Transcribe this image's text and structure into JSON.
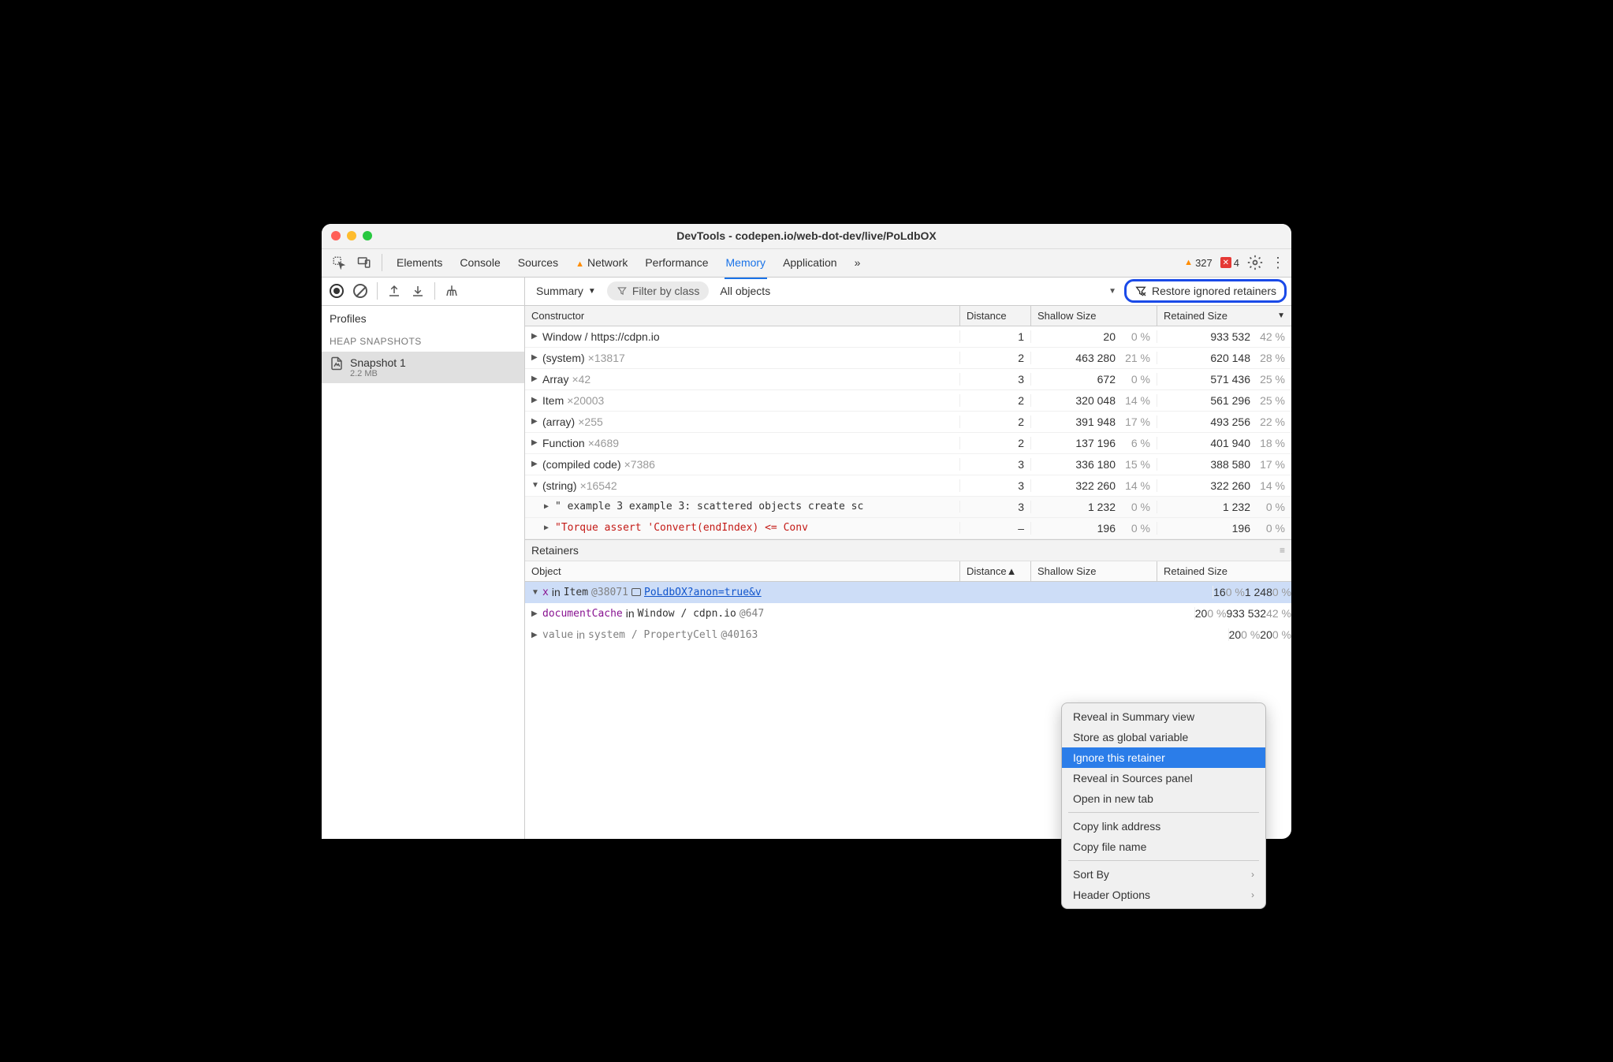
{
  "window_title": "DevTools - codepen.io/web-dot-dev/live/PoLdbOX",
  "tabs": [
    "Elements",
    "Console",
    "Sources",
    "Network",
    "Performance",
    "Memory",
    "Application"
  ],
  "active_tab": "Memory",
  "warn_tab": "Network",
  "status": {
    "warn_count": "327",
    "err_count": "4"
  },
  "restore_label": "Restore ignored retainers",
  "summary_dd": "Summary",
  "filter_placeholder": "Filter by class",
  "all_objects": "All objects",
  "sidebar": {
    "profiles": "Profiles",
    "heap": "HEAP SNAPSHOTS",
    "snap_name": "Snapshot 1",
    "snap_size": "2.2 MB"
  },
  "headers": {
    "constructor": "Constructor",
    "distance": "Distance",
    "shallow": "Shallow Size",
    "retained": "Retained Size",
    "object": "Object"
  },
  "rows": [
    {
      "arrow": "▶",
      "name": "Window / https://cdpn.io",
      "count": "",
      "dist": "1",
      "sv": "20",
      "sp": "0 %",
      "rv": "933 532",
      "rp": "42 %"
    },
    {
      "arrow": "▶",
      "name": "(system)",
      "count": "×13817",
      "dist": "2",
      "sv": "463 280",
      "sp": "21 %",
      "rv": "620 148",
      "rp": "28 %"
    },
    {
      "arrow": "▶",
      "name": "Array",
      "count": "×42",
      "dist": "3",
      "sv": "672",
      "sp": "0 %",
      "rv": "571 436",
      "rp": "25 %"
    },
    {
      "arrow": "▶",
      "name": "Item",
      "count": "×20003",
      "dist": "2",
      "sv": "320 048",
      "sp": "14 %",
      "rv": "561 296",
      "rp": "25 %"
    },
    {
      "arrow": "▶",
      "name": "(array)",
      "count": "×255",
      "dist": "2",
      "sv": "391 948",
      "sp": "17 %",
      "rv": "493 256",
      "rp": "22 %"
    },
    {
      "arrow": "▶",
      "name": "Function",
      "count": "×4689",
      "dist": "2",
      "sv": "137 196",
      "sp": "6 %",
      "rv": "401 940",
      "rp": "18 %"
    },
    {
      "arrow": "▶",
      "name": "(compiled code)",
      "count": "×7386",
      "dist": "3",
      "sv": "336 180",
      "sp": "15 %",
      "rv": "388 580",
      "rp": "17 %"
    },
    {
      "arrow": "▼",
      "name": "(string)",
      "count": "×16542",
      "dist": "3",
      "sv": "322 260",
      "sp": "14 %",
      "rv": "322 260",
      "rp": "14 %"
    }
  ],
  "child_rows": [
    {
      "arrow": "▶",
      "text": "\" example 3 example 3: scattered objects create sc",
      "dist": "3",
      "sv": "1 232",
      "sp": "0 %",
      "rv": "1 232",
      "rp": "0 %",
      "cls": ""
    },
    {
      "arrow": "▶",
      "text": "\"Torque assert 'Convert<uintptr>(endIndex) <= Conv",
      "dist": "–",
      "sv": "196",
      "sp": "0 %",
      "rv": "196",
      "rp": "0 %",
      "cls": "str-red"
    }
  ],
  "retainers_title": "Retainers",
  "ret_rows": [
    {
      "arrow": "▼",
      "prop": "x",
      "in": "in",
      "type": "Item",
      "id": "@38071",
      "iconbox": true,
      "link": "PoLdbOX?anon=true&v",
      "sel": true,
      "dist": "",
      "sv": "16",
      "sp": "0 %",
      "rv": "1 248",
      "rp": "0 %"
    },
    {
      "arrow": "▶",
      "prop": "documentCache",
      "in": "in",
      "type": "Window / cdpn.io",
      "id": "@647",
      "iconbox": false,
      "link": "",
      "sel": false,
      "dist": "",
      "sv": "20",
      "sp": "0 %",
      "rv": "933 532",
      "rp": "42 %"
    },
    {
      "arrow": "▶",
      "prop": "value",
      "in": "in",
      "type": "system / PropertyCell",
      "id": "@40163",
      "iconbox": false,
      "link": "",
      "sel": false,
      "gray": true,
      "dist": "",
      "sv": "20",
      "sp": "0 %",
      "rv": "20",
      "rp": "0 %"
    }
  ],
  "distance_sort_label": "Distance▲",
  "ctx": {
    "reveal_summary": "Reveal in Summary view",
    "store_global": "Store as global variable",
    "ignore": "Ignore this retainer",
    "reveal_sources": "Reveal in Sources panel",
    "open_tab": "Open in new tab",
    "copy_link": "Copy link address",
    "copy_file": "Copy file name",
    "sort": "Sort By",
    "header_opts": "Header Options"
  }
}
